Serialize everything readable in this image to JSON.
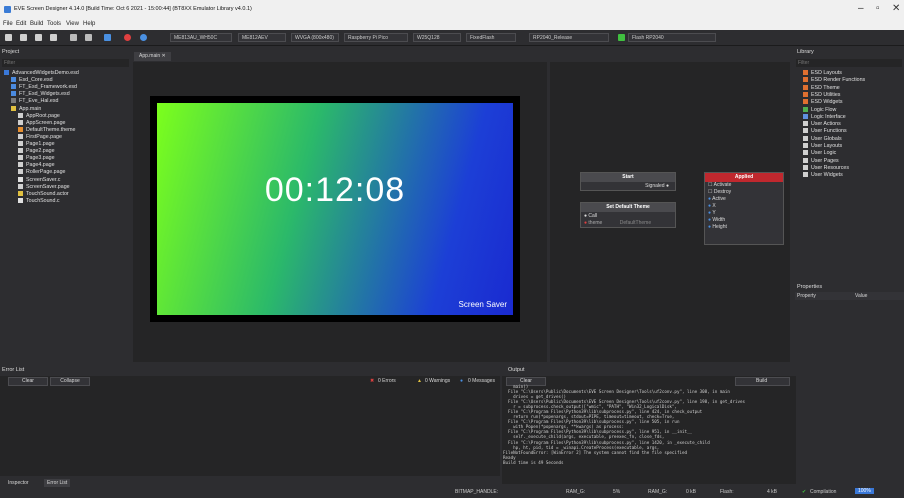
{
  "window": {
    "title": "EVE Screen Designer 4.14.0  [Build Time: Oct  6 2021 - 15:00:44]  (BT8XX Emulator Library v4.0.1)"
  },
  "menu": [
    "File",
    "Edit",
    "Build",
    "Tools",
    "View",
    "Help"
  ],
  "toolbar": {
    "platform": "ME813AU_WH50C",
    "board": "ME812AEV",
    "display": "WVGA (800x480)",
    "host": "Raspberry Pi Pico",
    "flash_chip": "W25Q128",
    "fixed": "FixedFlash",
    "build": "RP2040_Release",
    "flash": "Flash RP2040"
  },
  "project": {
    "title": "Project",
    "filter": "Filter",
    "items": [
      {
        "label": "AdvancedWidgetsDemo.esd",
        "icon": "project-icon",
        "color": "#3a78d8"
      },
      {
        "label": "Esd_Core.esd",
        "icon": "library-icon",
        "color": "#4b8be0"
      },
      {
        "label": "FT_Esd_Framework.esd",
        "icon": "library-icon",
        "color": "#4b8be0"
      },
      {
        "label": "FT_Esd_Widgets.esd",
        "icon": "library-icon",
        "color": "#4b8be0"
      },
      {
        "label": "FT_Eve_Hal.esd",
        "icon": "library-icon",
        "color": "#7a7a7a"
      },
      {
        "label": "App.main",
        "icon": "logic-icon",
        "color": "#e0c040"
      },
      {
        "label": "AppRoot.page",
        "icon": "page-icon",
        "color": "#cfcfcf"
      },
      {
        "label": "AppScreen.page",
        "icon": "page-icon",
        "color": "#cfcfcf"
      },
      {
        "label": "DefaultTheme.theme",
        "icon": "theme-icon",
        "color": "#e89030"
      },
      {
        "label": "FirstPage.page",
        "icon": "page-icon",
        "color": "#cfcfcf"
      },
      {
        "label": "Page1.page",
        "icon": "page-icon",
        "color": "#cfcfcf"
      },
      {
        "label": "Page2.page",
        "icon": "page-icon",
        "color": "#cfcfcf"
      },
      {
        "label": "Page3.page",
        "icon": "page-icon",
        "color": "#cfcfcf"
      },
      {
        "label": "Page4.page",
        "icon": "page-icon",
        "color": "#cfcfcf"
      },
      {
        "label": "RollerPage.page",
        "icon": "page-icon",
        "color": "#cfcfcf"
      },
      {
        "label": "ScreenSaver.c",
        "icon": "file-icon",
        "color": "#e0e0e0"
      },
      {
        "label": "ScreenSaver.page",
        "icon": "page-icon",
        "color": "#cfcfcf"
      },
      {
        "label": "TouchSound.actor",
        "icon": "actor-icon",
        "color": "#e0c040"
      },
      {
        "label": "TouchSound.c",
        "icon": "file-icon",
        "color": "#e0e0e0"
      }
    ]
  },
  "editor": {
    "tab": "App.main",
    "clock": "00:12:08",
    "screen_label": "Screen Saver"
  },
  "logic": {
    "start": {
      "title": "Start",
      "port": "Signaled"
    },
    "theme": {
      "title": "Set Default Theme",
      "call": "Call",
      "param": "theme",
      "value": "DefaultTheme"
    },
    "applied": {
      "title": "Applied",
      "ports": [
        "Activate",
        "Destroy",
        "Active",
        "X",
        "Y",
        "Width",
        "Height"
      ]
    }
  },
  "library": {
    "title": "Library",
    "filter": "Filter",
    "items": [
      {
        "label": "ESD Layouts",
        "color": "#e07030"
      },
      {
        "label": "ESD Render Functions",
        "color": "#e07030"
      },
      {
        "label": "ESD Theme",
        "color": "#e07030"
      },
      {
        "label": "ESD Utilities",
        "color": "#e07030"
      },
      {
        "label": "ESD Widgets",
        "color": "#e07030"
      },
      {
        "label": "Logic Flow",
        "color": "#50b050"
      },
      {
        "label": "Logic Interface",
        "color": "#6090e0"
      },
      {
        "label": "User Actions",
        "color": "#d0d0d0"
      },
      {
        "label": "User Functions",
        "color": "#d0d0d0"
      },
      {
        "label": "User Globals",
        "color": "#d0d0d0"
      },
      {
        "label": "User Layouts",
        "color": "#d0d0d0"
      },
      {
        "label": "User Logic",
        "color": "#d0d0d0"
      },
      {
        "label": "User Pages",
        "color": "#d0d0d0"
      },
      {
        "label": "User Resources",
        "color": "#d0d0d0"
      },
      {
        "label": "User Widgets",
        "color": "#d0d0d0"
      }
    ]
  },
  "properties": {
    "title": "Properties",
    "col_property": "Property",
    "col_value": "Value"
  },
  "errors": {
    "title": "Error List",
    "clear": "Clear",
    "collapse": "Collapse",
    "errors": "0 Errors",
    "warnings": "0 Warnings",
    "messages": "0 Messages",
    "tab_inspector": "Inspector",
    "tab_errors": "Error List"
  },
  "output": {
    "title": "Output",
    "clear": "Clear",
    "select": "Build",
    "lines": [
      "    main()",
      "  File \"C:\\Users\\Public\\Documents\\EVE Screen Designer\\Tools\\uf2conv.py\", line 308, in main",
      "    drives = get_drives()",
      "  File \"C:\\Users\\Public\\Documents\\EVE Screen Designer\\Tools\\uf2conv.py\", line 198, in get_drives",
      "    r = subprocess.check_output([\"wmic\", \"PATH\", \"Win32_LogicalDisk\",",
      "  File \"C:\\Program Files\\Python39\\lib\\subprocess.py\", line 424, in check_output",
      "    return run(*popenargs, stdout=PIPE, timeout=timeout, check=True,",
      "  File \"C:\\Program Files\\Python39\\lib\\subprocess.py\", line 505, in run",
      "    with Popen(*popenargs, **kwargs) as process:",
      "  File \"C:\\Program Files\\Python39\\lib\\subprocess.py\", line 951, in __init__",
      "    self._execute_child(args, executable, preexec_fn, close_fds,",
      "  File \"C:\\Program Files\\Python39\\lib\\subprocess.py\", line 1420, in _execute_child",
      "    hp, ht, pid, tid = _winapi.CreateProcess(executable, args,",
      "FileNotFoundError: [WinError 2] The system cannot find the file specified",
      "Ready",
      "Build time is 49 Seconds"
    ]
  },
  "status": {
    "bitmap": "BITMAP_HANDLE:",
    "ramg": "RAM_G:",
    "ramg_pct": "5%",
    "ramg2": "RAM_G:",
    "ramg2_val": "0 kB",
    "flash": "Flash:",
    "flash_val": "4 kB",
    "compilation": "Compilation",
    "compilation_pct": "100%"
  }
}
